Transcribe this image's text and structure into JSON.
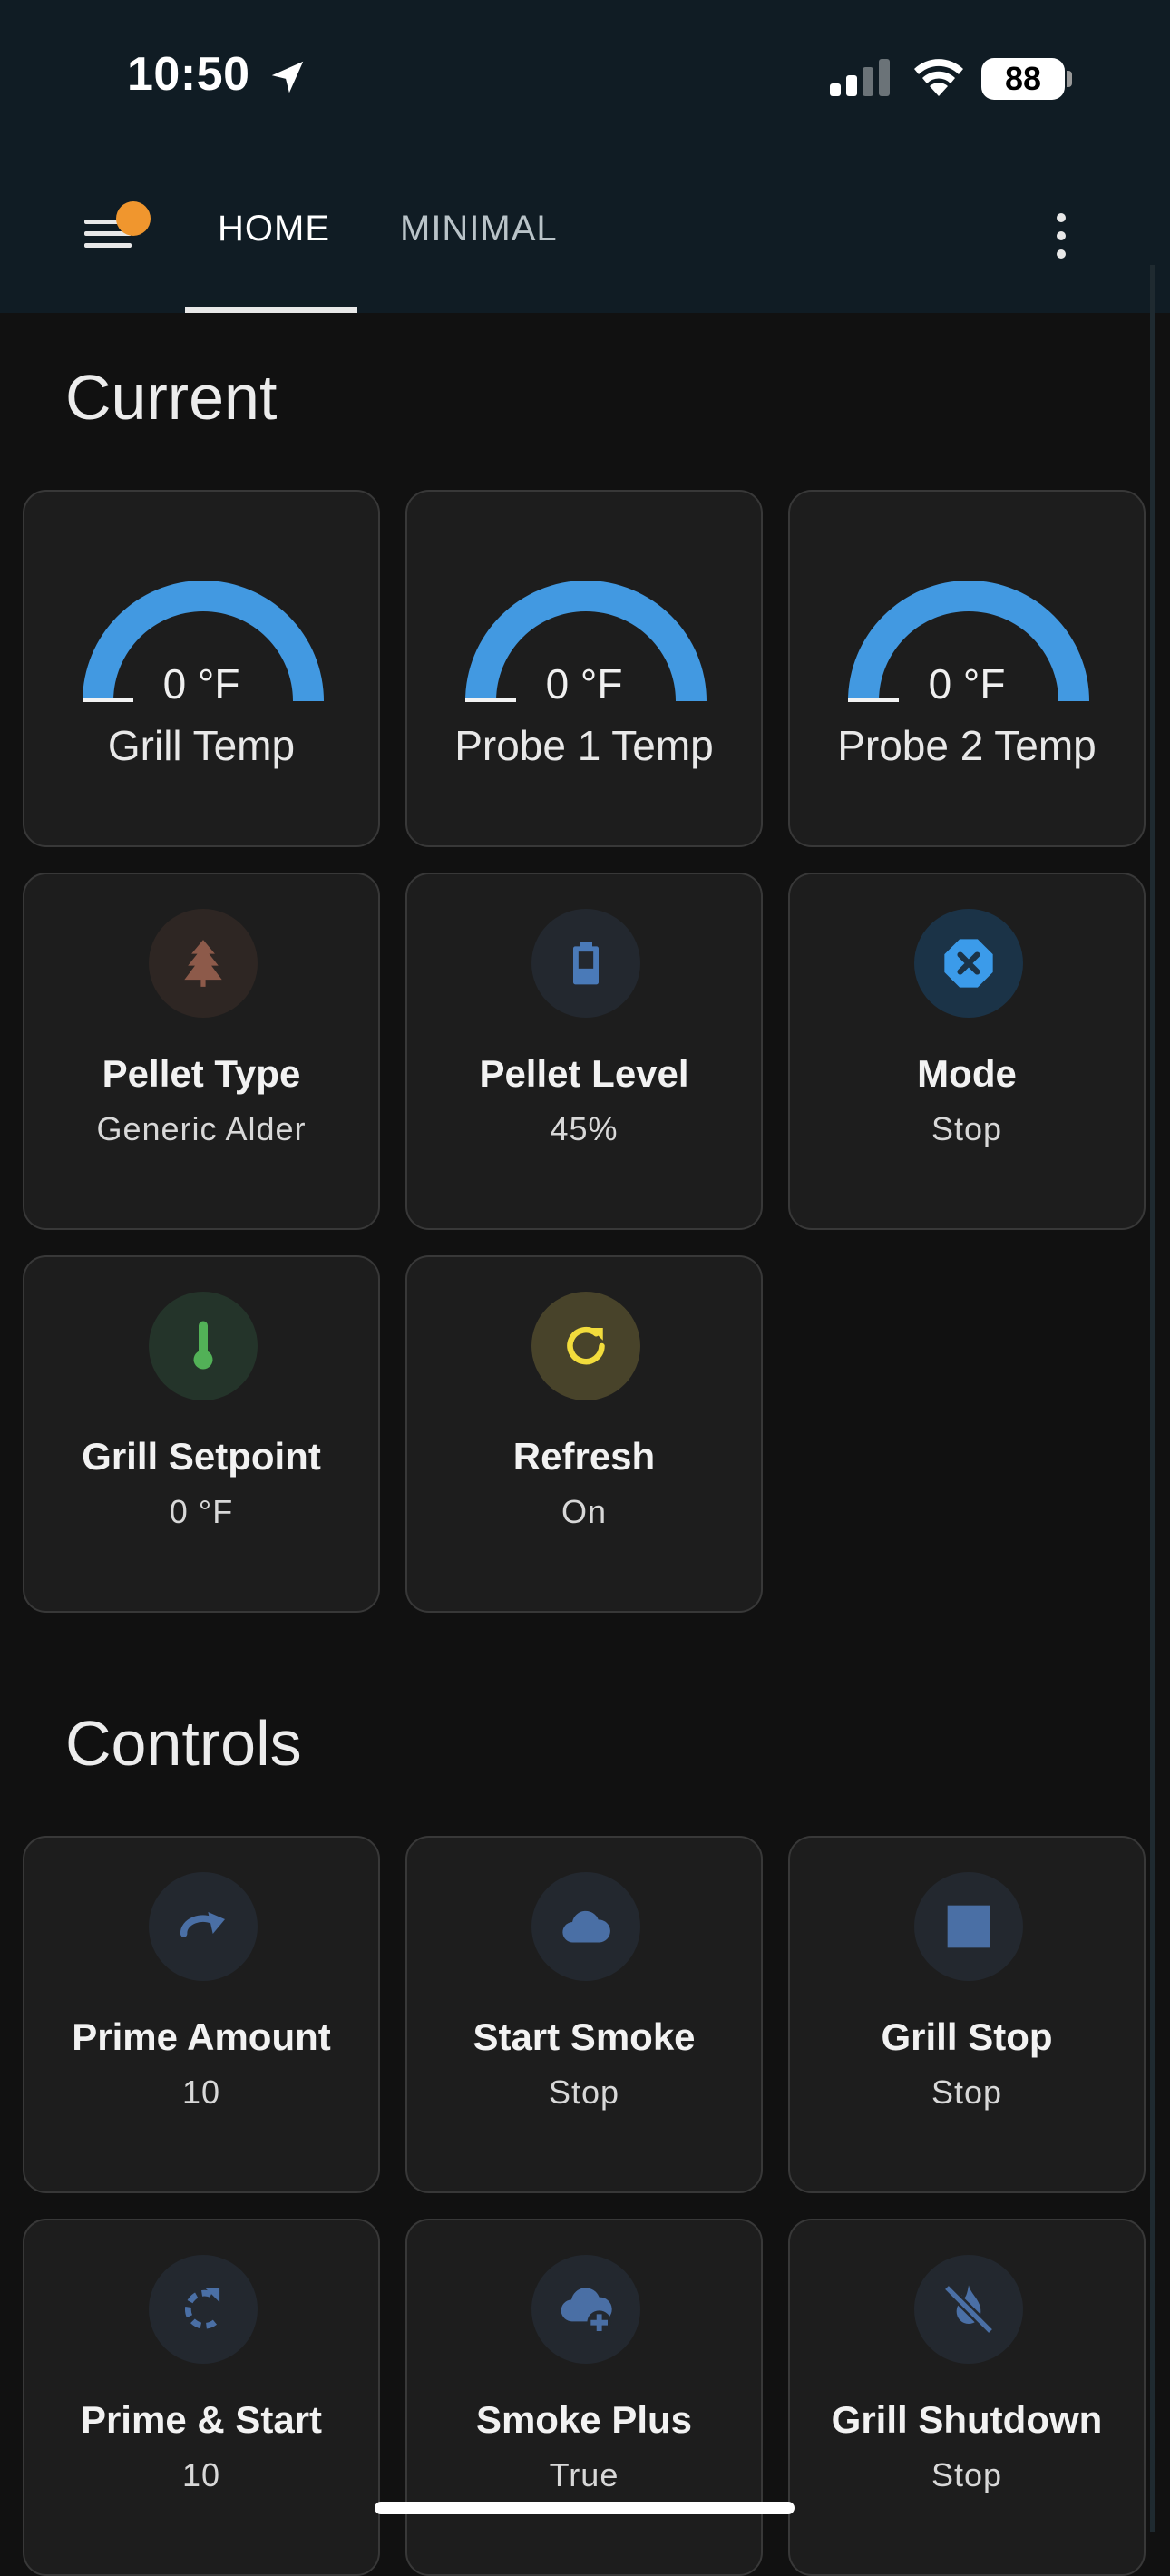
{
  "status_bar": {
    "time": "10:50",
    "battery": "88"
  },
  "header": {
    "tabs": [
      {
        "label": "HOME",
        "active": true
      },
      {
        "label": "MINIMAL",
        "active": false
      }
    ]
  },
  "sections": {
    "current": "Current",
    "controls": "Controls"
  },
  "gauges": [
    {
      "value": "0 °F",
      "label": "Grill Temp",
      "color": "#4299e1"
    },
    {
      "value": "0 °F",
      "label": "Probe 1 Temp",
      "color": "#4299e1"
    },
    {
      "value": "0 °F",
      "label": "Probe 2 Temp",
      "color": "#4299e1"
    }
  ],
  "current_tiles": [
    {
      "name": "Pellet Type",
      "state": "Generic Alder",
      "icon": "pine-tree-icon",
      "color": "#8d5a4a"
    },
    {
      "name": "Pellet Level",
      "state": "45%",
      "icon": "battery-icon",
      "color": "#4a7ab8"
    },
    {
      "name": "Mode",
      "state": "Stop",
      "icon": "close-octagon-icon",
      "color": "#3b9bea"
    },
    {
      "name": "Grill Setpoint",
      "state": "0 °F",
      "icon": "thermometer-icon",
      "color": "#52b157"
    },
    {
      "name": "Refresh",
      "state": "On",
      "icon": "refresh-icon",
      "color": "#f2dc3c"
    }
  ],
  "control_tiles": [
    {
      "name": "Prime Amount",
      "state": "10",
      "icon": "redo-icon",
      "color": "#4a6fa5"
    },
    {
      "name": "Start Smoke",
      "state": "Stop",
      "icon": "cloud-icon",
      "color": "#4a6fa5"
    },
    {
      "name": "Grill Stop",
      "state": "Stop",
      "icon": "stop-icon",
      "color": "#4a6fa5"
    },
    {
      "name": "Prime & Start",
      "state": "10",
      "icon": "rotate-icon",
      "color": "#4a6fa5"
    },
    {
      "name": "Smoke Plus",
      "state": "True",
      "icon": "cloud-plus-icon",
      "color": "#4a6fa5"
    },
    {
      "name": "Grill Shutdown",
      "state": "Stop",
      "icon": "fire-off-icon",
      "color": "#4a6fa5"
    }
  ]
}
